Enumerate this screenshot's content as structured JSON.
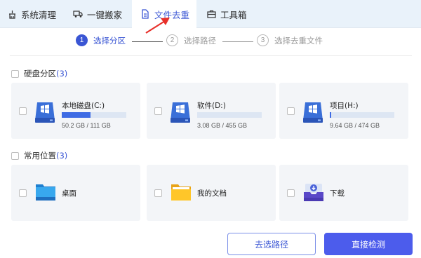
{
  "tabs": [
    {
      "label": "系统清理",
      "icon": "system-clean-icon"
    },
    {
      "label": "一键搬家",
      "icon": "truck-icon"
    },
    {
      "label": "文件去重",
      "icon": "file-dedupe-icon",
      "active": true
    },
    {
      "label": "工具箱",
      "icon": "toolbox-icon"
    }
  ],
  "steps": [
    {
      "num": "1",
      "label": "选择分区",
      "active": true
    },
    {
      "num": "2",
      "label": "选择路径"
    },
    {
      "num": "3",
      "label": "选择去重文件"
    }
  ],
  "disk_section": {
    "title": "硬盘分区",
    "count": "(3)"
  },
  "drives": [
    {
      "name": "本地磁盘(C:)",
      "size": "50.2 GB / 111 GB",
      "used_fraction": 0.45
    },
    {
      "name": "软件(D:)",
      "size": "3.08 GB / 455 GB",
      "used_fraction": 0.0
    },
    {
      "name": "项目(H:)",
      "size": "9.64 GB / 474 GB",
      "used_fraction": 0.02
    }
  ],
  "common_section": {
    "title": "常用位置",
    "count": "(3)"
  },
  "locations": [
    {
      "name": "桌面",
      "icon": "desktop-folder-icon"
    },
    {
      "name": "我的文档",
      "icon": "documents-folder-icon"
    },
    {
      "name": "下载",
      "icon": "download-folder-icon"
    }
  ],
  "buttons": {
    "choose_path": "去选路径",
    "scan": "直接检测"
  },
  "colors": {
    "accent": "#3a56d4",
    "scan_button": "#4c5cec",
    "annotation": "#e8302a",
    "bar_fill": "#3e6be4"
  }
}
